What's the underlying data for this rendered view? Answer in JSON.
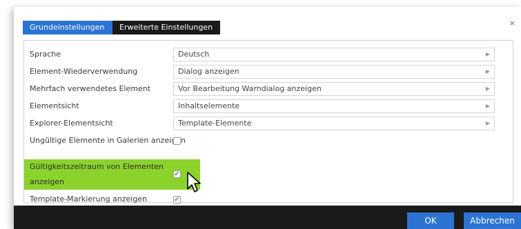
{
  "tabs": [
    {
      "label": "Grundeinstellungen",
      "active": true
    },
    {
      "label": "Erweiterte Einstellungen",
      "active": false
    }
  ],
  "close_glyph": "×",
  "select_rows": [
    {
      "label": "Sprache",
      "value": "Deutsch"
    },
    {
      "label": "Element-Wiederverwendung",
      "value": "Dialog anzeigen"
    },
    {
      "label": "Mehrfach verwendetes Element",
      "value": "Vor Bearbeitung Warndialog anzeigen"
    },
    {
      "label": "Elementsicht",
      "value": "Inhaltselemente"
    },
    {
      "label": "Explorer-Elementsicht",
      "value": "Template-Elemente"
    }
  ],
  "checkbox_rows": [
    {
      "label": "Ungültige Elemente in Galerien anzeigen",
      "checked": false
    },
    {
      "label": "Gültigkeitszeitraum von Elementen anzeigen",
      "checked": true,
      "highlighted": true
    },
    {
      "label": "Template-Markierung anzeigen",
      "checked": true
    }
  ],
  "buttons": {
    "ok": "OK",
    "cancel": "Abbrechen"
  },
  "colors": {
    "accent": "#2d74d2",
    "dark_bar": "#1a1a1a",
    "highlight": "#8bd32c"
  },
  "icons": {
    "select_arrow": "chevron-right-icon",
    "cursor": "mouse-pointer-icon"
  }
}
